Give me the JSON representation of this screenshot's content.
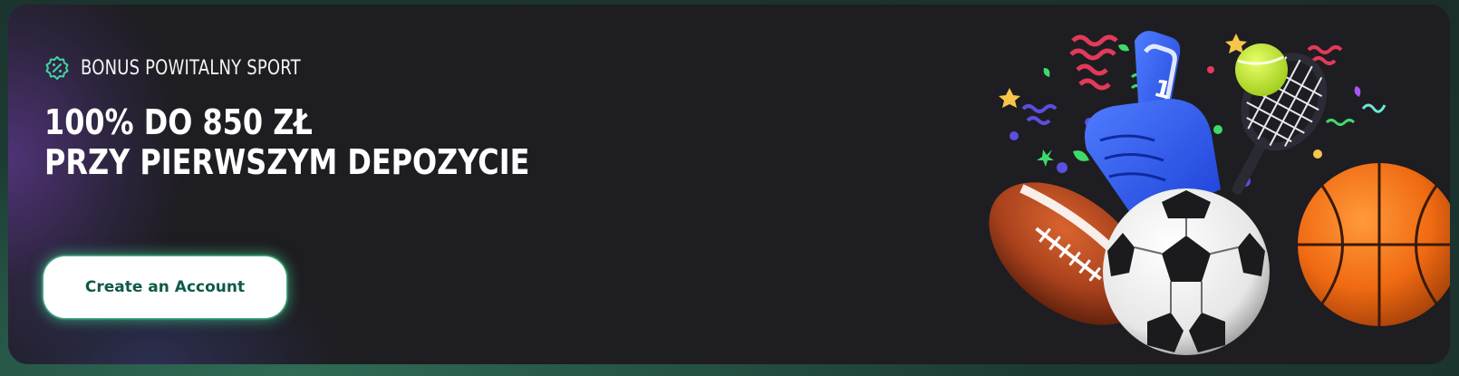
{
  "promo": {
    "badge_label": "BONUS POWITALNY SPORT",
    "badge_icon": "percent-badge-icon",
    "headline_line1": "100% DO 850 ZŁ",
    "headline_line2": "PRZY PIERWSZYM DEPOZYCIE",
    "cta_label": "Create an Account",
    "foam_finger_number": "1"
  },
  "colors": {
    "accent": "#3fd7a3",
    "cta_text": "#0f5a4a",
    "banner_bg": "#1e1d21"
  },
  "illustration": {
    "items": [
      "american-football-icon",
      "soccer-ball-icon",
      "basketball-icon",
      "foam-finger-icon",
      "tennis-racket-icon",
      "tennis-ball-icon",
      "confetti"
    ]
  }
}
